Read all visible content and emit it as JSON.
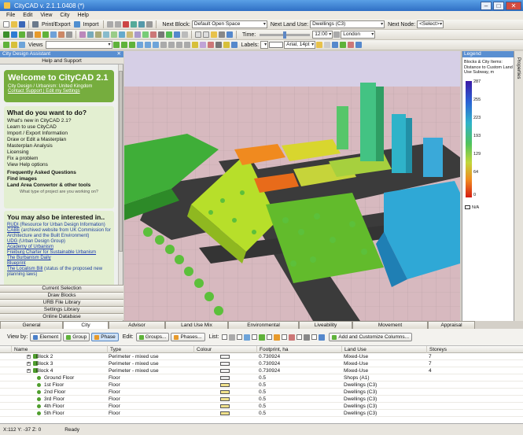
{
  "window": {
    "title": "CityCAD v. 2.1.1.0408 (*)"
  },
  "menu": [
    "File",
    "Edit",
    "View",
    "City",
    "Help"
  ],
  "toolbar": {
    "print_export": "Print/Export",
    "import": "Import",
    "next_block_label": "Next Block:",
    "next_block_value": "Default Open Space",
    "next_land_use_label": "Next Land Use:",
    "next_land_use_value": "Dwellings (C3)",
    "next_node_label": "Next Node:",
    "next_node_value": "<Select>",
    "time_label": "Time:",
    "time_value": "12:00",
    "location_value": "London",
    "views_label": "Views",
    "labels_label": "Labels:",
    "font_value": "Arial, 14pt"
  },
  "left_panel": {
    "title": "City Design Assistant",
    "subtitle": "Help and Support",
    "welcome": {
      "heading": "Welcome to CityCAD 2.1",
      "subline": "City Design / Urbanism: United Kingdom",
      "links": "Contact Support | Edit my Settings"
    },
    "what_heading": "What do you want to do?",
    "what_items": [
      "What's new in CityCAD 2.1?",
      "Learn to use CityCAD",
      "Import / Export Information",
      "Draw or Edit a Masterplan",
      "Masterplan Analysis",
      "Licensing",
      "Fix a problem",
      "View Help options"
    ],
    "what_bold": [
      "Frequently Asked Questions",
      "Find images",
      "Land Area Convertor & other tools"
    ],
    "what_note": "What type of project are you working on?",
    "also_heading": "You may also be interested in..",
    "also_items": [
      {
        "link": "RUDI",
        "rest": " (Resource for Urban Design Information)"
      },
      {
        "link": "CABE",
        "rest": " (archived website from UK Commission for Architecture and the Built Environment)"
      },
      {
        "link": "UDG",
        "rest": " (Urban Design Group)"
      },
      {
        "link": "Academy of Urbanism",
        "rest": ""
      },
      {
        "link": "Freiburg Charter for Sustainable Urbanism",
        "rest": ""
      },
      {
        "link": "The Burbanism Daily",
        "rest": ""
      },
      {
        "link": "Blueprint",
        "rest": ""
      },
      {
        "link": "The Localism Bill",
        "rest": " (status of the proposed new planning laws)"
      }
    ],
    "tabs": [
      "Current Selection",
      "Draw Blocks",
      "URB File Library",
      "Settings Library",
      "Online Database"
    ]
  },
  "legend": {
    "title": "Legend",
    "description": "Blocks & City Items: Distance to Custom Land Use Subway, m",
    "values": [
      "287",
      "255",
      "223",
      "193",
      "129",
      "64",
      "0"
    ],
    "na": "N/A",
    "colors": [
      "#3b1aa6",
      "#2a63d4",
      "#2fb3c9",
      "#4fc35c",
      "#c1d63b",
      "#f08a1f",
      "#d41d13"
    ]
  },
  "properties_tab": "Properties",
  "bottom_tabs": [
    "General",
    "City",
    "Advisor",
    "Land Use Mix",
    "Environmental",
    "Liveability",
    "Movement",
    "Appraisal"
  ],
  "active_tab": "City",
  "viewbar": {
    "view_by": "View by:",
    "element": "Element",
    "group": "Group",
    "phase": "Phase",
    "edit": "Edit:",
    "groups": "Groups...",
    "phases": "Phases...",
    "list": "List:",
    "add_columns": "Add and Customize Columns..."
  },
  "grid": {
    "columns": [
      "Name",
      "Type",
      "Colour",
      "Footprint, ha",
      "Land Use",
      "Storeys"
    ],
    "rows": [
      {
        "name": "Block 2",
        "type": "Perimeter - mixed use",
        "colour": "#f2f2f2",
        "footprint": "0.730924",
        "land_use": "Mixed-Use",
        "storeys": "7",
        "level": 0
      },
      {
        "name": "Block 3",
        "type": "Perimeter - mixed use",
        "colour": "#f2f2f2",
        "footprint": "0.730924",
        "land_use": "Mixed-Use",
        "storeys": "7",
        "level": 0
      },
      {
        "name": "Block 4",
        "type": "Perimeter - mixed use",
        "colour": "#f2f2f2",
        "footprint": "0.730924",
        "land_use": "Mixed-Use",
        "storeys": "4",
        "level": 0
      },
      {
        "name": "Ground Floor",
        "type": "Floor",
        "colour": "#e6e6e6",
        "footprint": "0.5",
        "land_use": "Shops (A1)",
        "storeys": "",
        "level": 1
      },
      {
        "name": "1st Floor",
        "type": "Floor",
        "colour": "#efe08a",
        "footprint": "0.5",
        "land_use": "Dwellings (C3)",
        "storeys": "",
        "level": 1
      },
      {
        "name": "2nd Floor",
        "type": "Floor",
        "colour": "#efe08a",
        "footprint": "0.5",
        "land_use": "Dwellings (C3)",
        "storeys": "",
        "level": 1
      },
      {
        "name": "3rd Floor",
        "type": "Floor",
        "colour": "#efe08a",
        "footprint": "0.5",
        "land_use": "Dwellings (C3)",
        "storeys": "",
        "level": 1
      },
      {
        "name": "4th Floor",
        "type": "Floor",
        "colour": "#efe08a",
        "footprint": "0.5",
        "land_use": "Dwellings (C3)",
        "storeys": "",
        "level": 1
      },
      {
        "name": "5th Floor",
        "type": "Floor",
        "colour": "#efe08a",
        "footprint": "0.5",
        "land_use": "Dwellings (C3)",
        "storeys": "",
        "level": 1
      }
    ]
  },
  "status": {
    "coords": "X:112 Y: -37 Z: 0",
    "state": "Ready"
  }
}
